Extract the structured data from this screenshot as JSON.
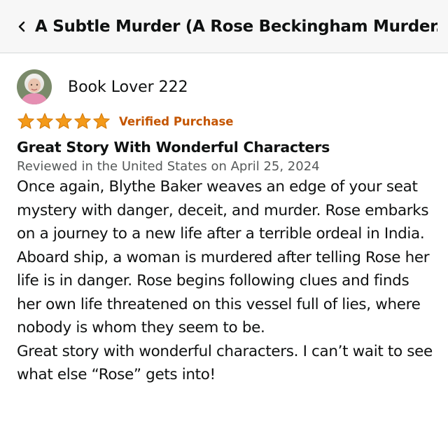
{
  "header": {
    "title": "A Subtle Murder (A Rose Beckingham Murder..."
  },
  "review": {
    "profile_name": "Book Lover 222",
    "rating": 5,
    "rating_max": 5,
    "verified_label": "Verified Purchase",
    "title": "Great Story With Wonderful Characters",
    "meta": "Reviewed in the United States on April 25, 2024",
    "body_paragraphs": [
      "Once again, Blythe Baker weaves an edge of your seat mystery with danger, deceit, and murder. Rose embarks on a journey to a new life after a terrible ordeal in India. Aboard ship, a woman is murdered after telling Rose her life is in danger. Rose begins following clues and finds her own life threatened on this vessel full of lies, where nobody is whom they seem to be.",
      "Great story with wonderful characters. I can’t wait to see what else “Rose” gets into!"
    ]
  },
  "colors": {
    "star": "#f49a1a",
    "verified": "#c45500",
    "meta": "#565959",
    "header_bg": "#f7f7f7"
  },
  "icons": {
    "back": "chevron-left-icon",
    "star": "star-icon"
  }
}
